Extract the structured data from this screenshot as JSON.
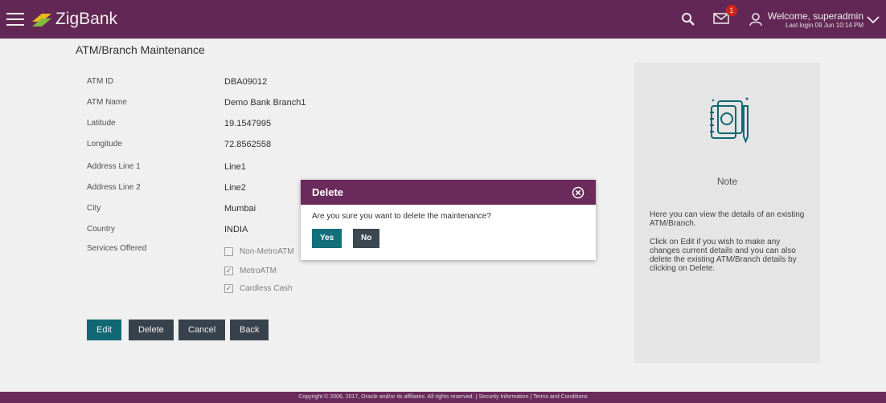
{
  "brand": {
    "name": "ZigBank"
  },
  "header": {
    "mail_count": "1",
    "welcome": "Welcome, superadmin",
    "last_login": "Last login 09 Jun 10:14 PM"
  },
  "page": {
    "title": "ATM/Branch Maintenance"
  },
  "details": [
    {
      "label": "ATM ID",
      "value": "DBA09012"
    },
    {
      "label": "ATM Name",
      "value": "Demo Bank Branch1"
    },
    {
      "label": "Latitude",
      "value": "19.1547995"
    },
    {
      "label": "Longitude",
      "value": "72.8562558"
    },
    {
      "label": "Address Line 1",
      "value": "Line1"
    },
    {
      "label": "Address Line 2",
      "value": "Line2"
    },
    {
      "label": "City",
      "value": "Mumbai"
    },
    {
      "label": "Country",
      "value": "INDIA"
    }
  ],
  "services": {
    "label": "Services Offered",
    "options": [
      {
        "label": "Non-MetroATM",
        "checked": false
      },
      {
        "label": "MetroATM",
        "checked": true
      },
      {
        "label": "Cardless Cash",
        "checked": true
      }
    ]
  },
  "actions": {
    "edit": "Edit",
    "delete": "Delete",
    "cancel": "Cancel",
    "back": "Back"
  },
  "note": {
    "title": "Note",
    "p1": "Here you can view the details of an existing ATM/Branch.",
    "p2": "Click on Edit if you wish to make any changes current details and you can also delete the existing ATM/Branch details by clicking on Delete."
  },
  "modal": {
    "title": "Delete",
    "message": "Are you sure you want to delete the maintenance?",
    "yes": "Yes",
    "no": "No"
  },
  "footer": {
    "text": "Copyright © 2006, 2017, Oracle and/or its affiliates. All rights reserved. | Security Information | Terms and Conditions"
  },
  "colors": {
    "header": "#6a2a5b",
    "primary_button": "#136f7a",
    "secondary_button": "#3c4751",
    "badge": "#e0251b"
  }
}
